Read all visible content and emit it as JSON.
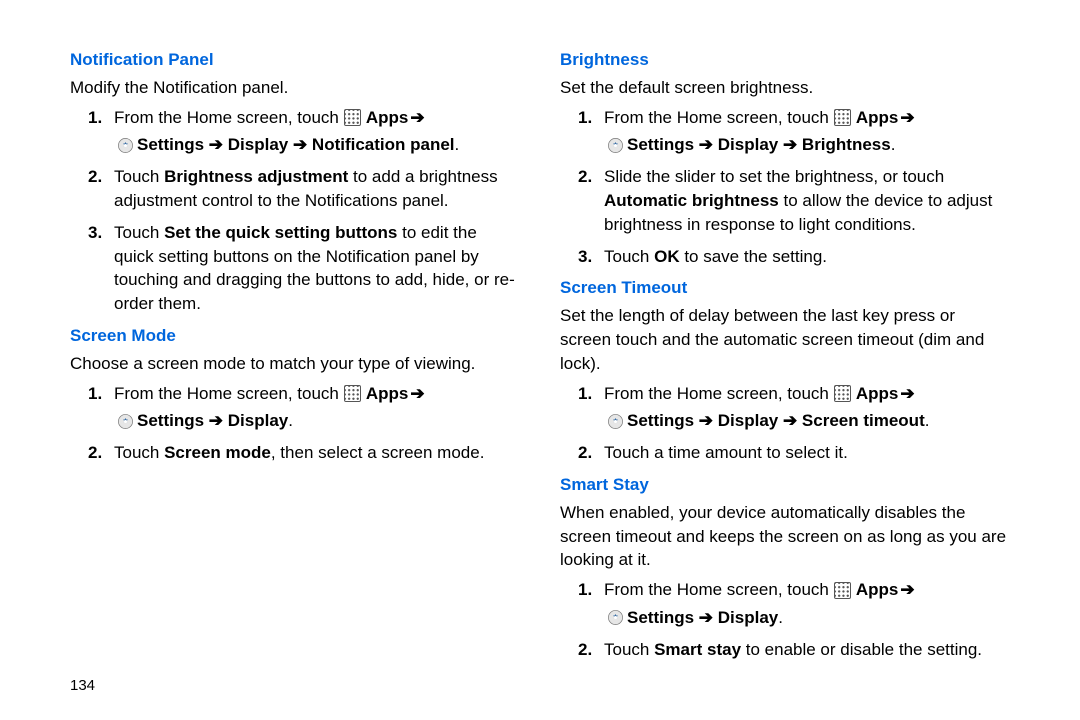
{
  "page_number": "134",
  "arrow": "➔",
  "left": {
    "sections": [
      {
        "heading": "Notification Panel",
        "intro": "Modify the Notification panel.",
        "step1_pre": "From the Home screen, touch ",
        "step1_apps": "Apps",
        "step1_path": "Settings ➔ Display ➔ Notification panel",
        "step2_a": "Touch ",
        "step2_b": "Brightness adjustment",
        "step2_c": " to add a brightness adjustment control to the Notifications panel.",
        "step3_a": "Touch ",
        "step3_b": "Set the quick setting buttons",
        "step3_c": " to edit the quick setting buttons on the Notification panel by touching and dragging the buttons to add, hide, or re-order them."
      },
      {
        "heading": "Screen Mode",
        "intro": "Choose a screen mode to match your type of viewing.",
        "step1_pre": "From the Home screen, touch ",
        "step1_apps": "Apps",
        "step1_path": "Settings ➔ Display",
        "step2_a": "Touch ",
        "step2_b": "Screen mode",
        "step2_c": ", then select a screen mode."
      }
    ]
  },
  "right": {
    "sections": [
      {
        "heading": "Brightness",
        "intro": "Set the default screen brightness.",
        "step1_pre": "From the Home screen, touch ",
        "step1_apps": "Apps",
        "step1_path": "Settings ➔ Display ➔ Brightness",
        "step2_a": "Slide the slider to set the brightness, or touch ",
        "step2_b": "Automatic brightness",
        "step2_c": " to allow the device to adjust brightness in response to light conditions.",
        "step3_a": "Touch ",
        "step3_b": "OK",
        "step3_c": " to save the setting."
      },
      {
        "heading": "Screen Timeout",
        "intro": "Set the length of delay between the last key press or screen touch and the automatic screen timeout (dim and lock).",
        "step1_pre": "From the Home screen, touch ",
        "step1_apps": "Apps",
        "step1_path": "Settings ➔ Display ➔ Screen timeout",
        "step2_a": "Touch a time amount to select it.",
        "step2_b": "",
        "step2_c": ""
      },
      {
        "heading": "Smart Stay",
        "intro": "When enabled, your device automatically disables the screen timeout and keeps the screen on as long as you are looking at it.",
        "step1_pre": "From the Home screen, touch ",
        "step1_apps": "Apps",
        "step1_path": "Settings ➔ Display",
        "step2_a": "Touch ",
        "step2_b": "Smart stay",
        "step2_c": " to enable or disable the setting."
      }
    ]
  }
}
